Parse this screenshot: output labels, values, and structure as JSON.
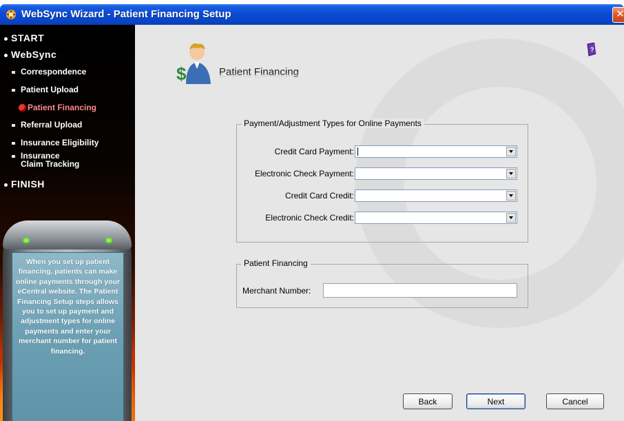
{
  "window": {
    "title": "WebSync Wizard - Patient Financing Setup",
    "close_glyph": "✕"
  },
  "sidebar": {
    "items": [
      {
        "label": "START",
        "level": "top"
      },
      {
        "label": "WebSync",
        "level": "top"
      },
      {
        "label": "Correspondence",
        "level": "sub"
      },
      {
        "label": "Patient Upload",
        "level": "sub"
      },
      {
        "label": "Patient Financing",
        "level": "sub",
        "active": true
      },
      {
        "label": "Referral Upload",
        "level": "sub"
      },
      {
        "label": "Insurance Eligibility",
        "level": "sub"
      },
      {
        "label": "Insurance",
        "level": "sub"
      },
      {
        "label": "Claim Tracking",
        "level": "sub-cont"
      },
      {
        "label": "FINISH",
        "level": "top"
      }
    ],
    "info_text": "When you set up patient financing, patients can make online payments through your eCentral website. The Patient Financing Setup steps allows you to set up payment and adjustment types for online payments and enter your merchant number for patient financing."
  },
  "header": {
    "title": "Patient Financing",
    "icon": "money-person-icon",
    "help_icon": "help-book-icon"
  },
  "payment_group": {
    "legend": "Payment/Adjustment Types for Online Payments",
    "fields": [
      {
        "label": "Credit Card Payment:",
        "value": ""
      },
      {
        "label": "Electronic Check Payment:",
        "value": ""
      },
      {
        "label": "Credit Card Credit:",
        "value": ""
      },
      {
        "label": "Electronic Check Credit:",
        "value": ""
      }
    ]
  },
  "financing_group": {
    "legend": "Patient Financing",
    "merchant_label": "Merchant Number:",
    "merchant_value": ""
  },
  "buttons": {
    "back": "Back",
    "next": "Next",
    "cancel": "Cancel"
  },
  "colors": {
    "title_bar": "#0a4bd6",
    "close_button": "#e05a2a",
    "active_nav": "#ff8a8a",
    "info_panel": "#6b9fb3"
  }
}
